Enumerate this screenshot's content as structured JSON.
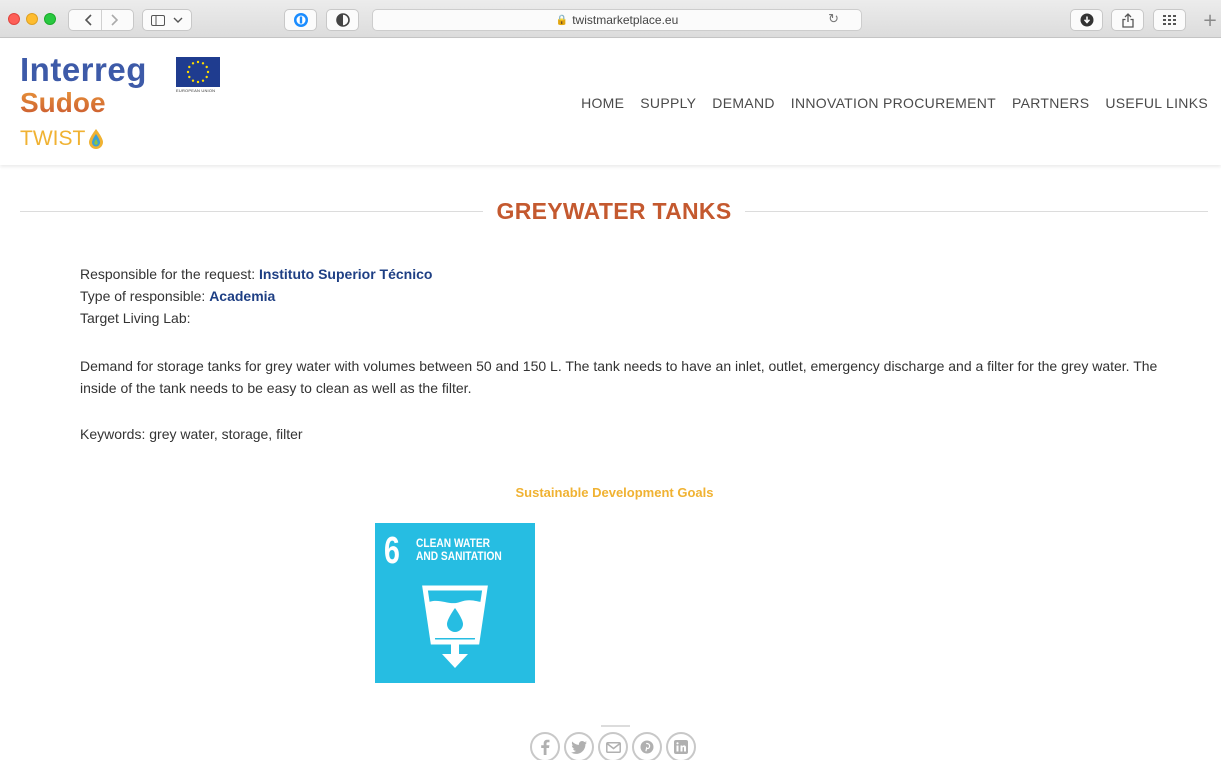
{
  "browser": {
    "url": "twistmarketplace.eu",
    "new_tab_symbol": "+"
  },
  "header": {
    "logo": {
      "line1": "Interreg",
      "line2": "Sudoe",
      "line3": "TWIST",
      "eu_caption": "EUROPEAN UNION"
    },
    "nav": [
      {
        "label": "HOME"
      },
      {
        "label": "SUPPLY"
      },
      {
        "label": "DEMAND"
      },
      {
        "label": "INNOVATION PROCUREMENT"
      },
      {
        "label": "PARTNERS"
      },
      {
        "label": "USEFUL LINKS"
      }
    ]
  },
  "page": {
    "title": "GREYWATER TANKS",
    "responsible_label": "Responsible for the request:",
    "responsible_value": "Instituto Superior Técnico",
    "type_label": "Type of responsible:",
    "type_value": "Academia",
    "living_lab_label": "Target Living Lab:",
    "description": "Demand for storage tanks for grey water with volumes between 50 and 150 L. The tank needs to have an inlet, outlet, emergency discharge and a filter for the grey water. The inside of the tank needs to be easy to clean as well as the filter.",
    "keywords": "Keywords: grey water, storage, filter",
    "sdg_heading": "Sustainable Development Goals",
    "sdg": {
      "number": "6",
      "line1": "CLEAN WATER",
      "line2": "AND SANITATION",
      "color": "#26bde2"
    }
  },
  "share": [
    "facebook",
    "twitter",
    "email",
    "pinterest",
    "linkedin"
  ],
  "colors": {
    "title": "#c4592f",
    "link": "#1e3f84",
    "sdg_heading": "#f0b232"
  }
}
